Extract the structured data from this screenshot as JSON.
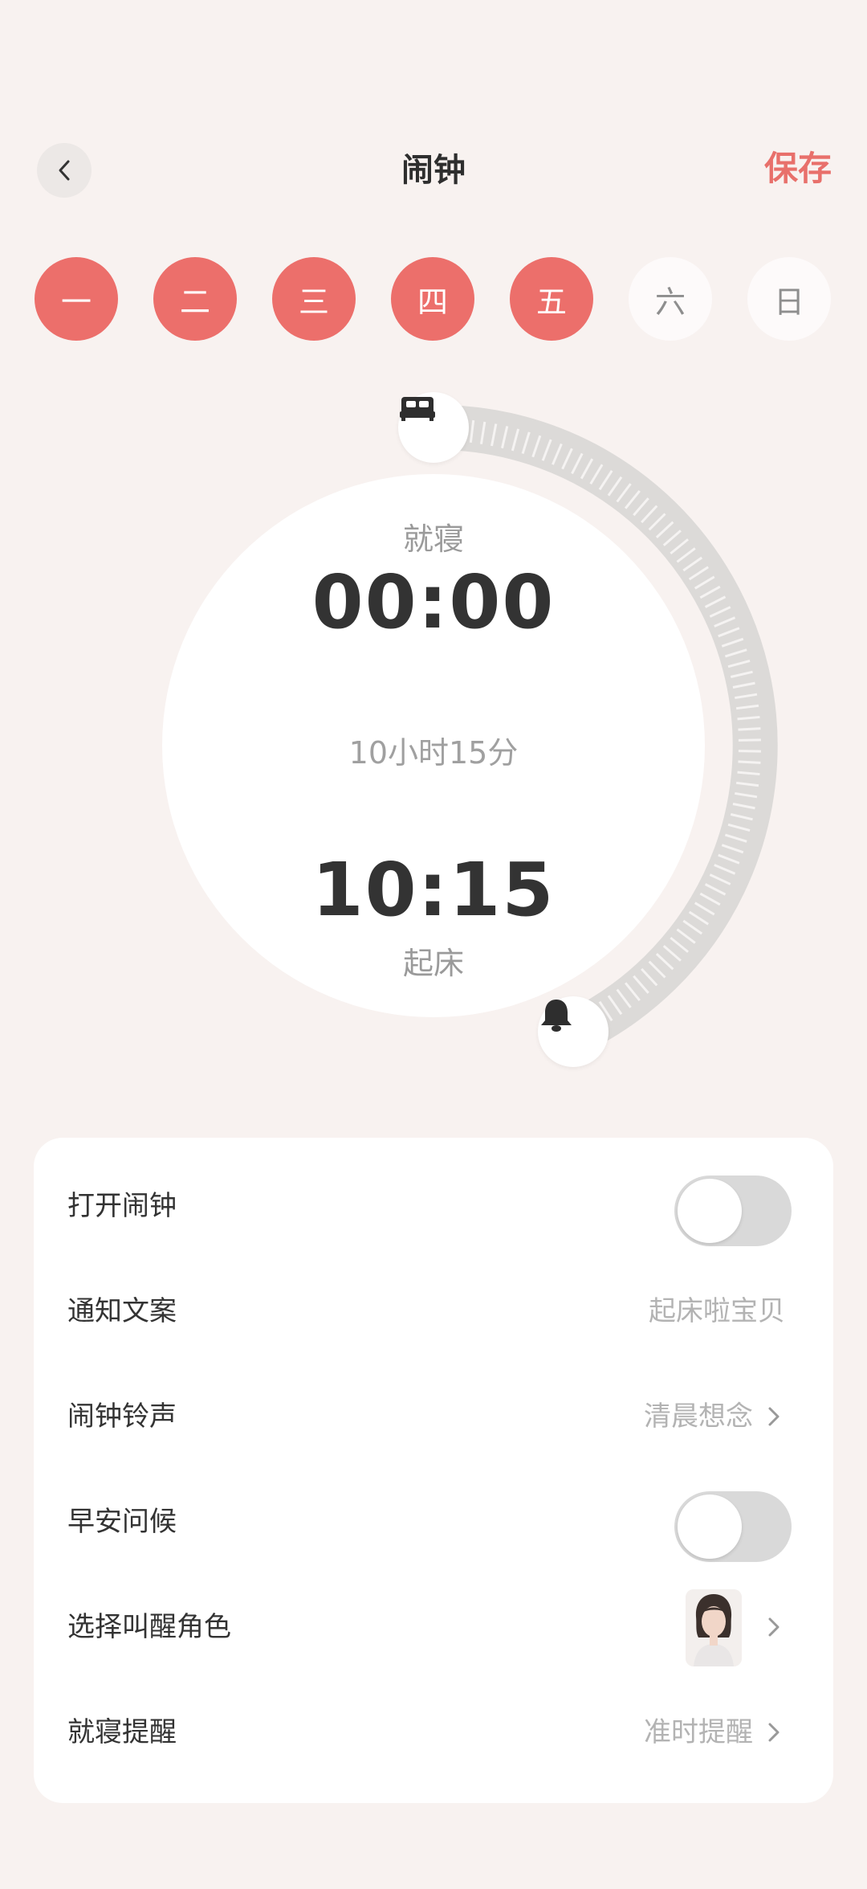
{
  "header": {
    "title": "闹钟",
    "save_label": "保存",
    "back_icon": "chevron-left-icon"
  },
  "days": [
    {
      "label": "一",
      "selected": true
    },
    {
      "label": "二",
      "selected": true
    },
    {
      "label": "三",
      "selected": true
    },
    {
      "label": "四",
      "selected": true
    },
    {
      "label": "五",
      "selected": true
    },
    {
      "label": "六",
      "selected": false
    },
    {
      "label": "日",
      "selected": false
    }
  ],
  "dial": {
    "sleep_label": "就寝",
    "sleep_time": "00:00",
    "duration": "10小时15分",
    "wake_time": "10:15",
    "wake_label": "起床",
    "sleep_icon": "bed-icon",
    "wake_icon": "bell-icon"
  },
  "settings": {
    "open_alarm": {
      "label": "打开闹钟",
      "on": false
    },
    "notify_text": {
      "label": "通知文案",
      "value": "起床啦宝贝"
    },
    "ringtone": {
      "label": "闹钟铃声",
      "value": "清晨想念"
    },
    "morning_greeting": {
      "label": "早安问候",
      "on": false
    },
    "wake_character": {
      "label": "选择叫醒角色",
      "avatar_icon": "character-avatar"
    },
    "bedtime_reminder": {
      "label": "就寝提醒",
      "value": "准时提醒"
    }
  },
  "colors": {
    "accent": "#ec6f6b",
    "background": "#f8f2f0",
    "track": "#dcdad8"
  }
}
